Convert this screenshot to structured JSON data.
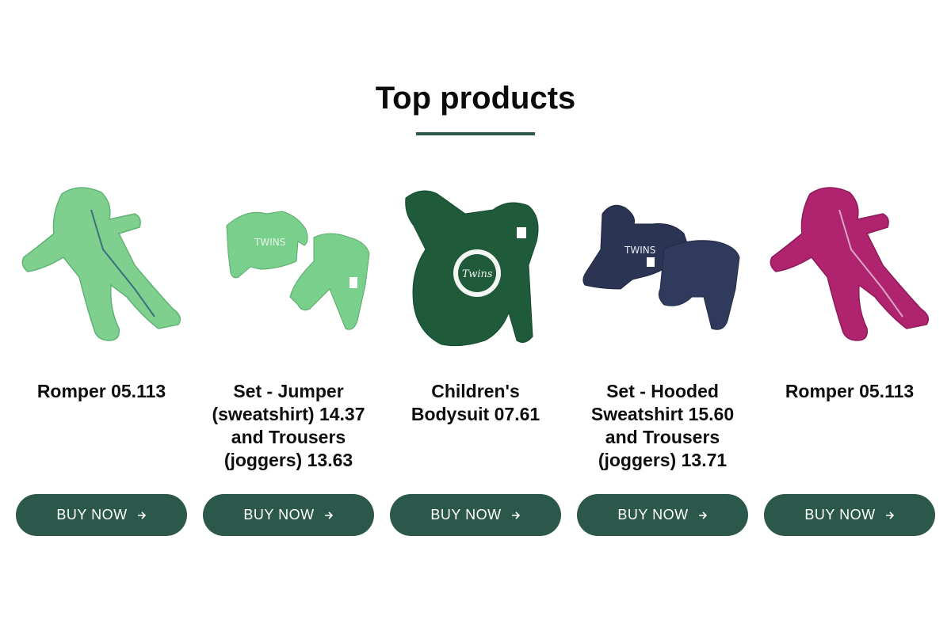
{
  "section": {
    "title": "Top products"
  },
  "colors": {
    "accent": "#2c574b"
  },
  "products": [
    {
      "name": "Romper 05.113",
      "button": "BUY NOW",
      "image": "green-romper",
      "color": "#7fd08f"
    },
    {
      "name": "Set - Jumper (sweatshirt) 14.37 and Trousers (joggers) 13.63",
      "button": "BUY NOW",
      "image": "green-jumper-set",
      "color": "#79cf8c"
    },
    {
      "name": "Children's Bodysuit 07.61",
      "button": "BUY NOW",
      "image": "dark-green-bodysuit",
      "color": "#1f5a3a"
    },
    {
      "name": "Set - Hooded Sweatshirt 15.60 and Trousers (joggers) 13.71",
      "button": "BUY NOW",
      "image": "navy-hoodie-set",
      "color": "#2b3452"
    },
    {
      "name": "Romper 05.113",
      "button": "BUY NOW",
      "image": "magenta-romper",
      "color": "#b0246f"
    }
  ]
}
